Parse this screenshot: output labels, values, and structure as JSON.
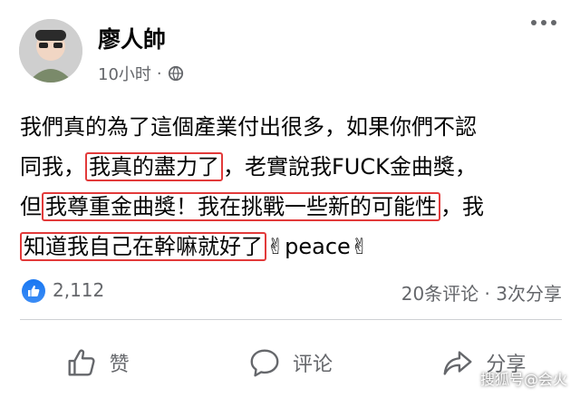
{
  "post": {
    "author": "廖人帥",
    "time": "10小时",
    "dot": "·",
    "lines": [
      {
        "parts": [
          {
            "t": "我們真的為了這個產業付出很多，如果你們不認",
            "hl": false
          }
        ]
      },
      {
        "parts": [
          {
            "t": "同我，",
            "hl": false
          },
          {
            "t": "我真的盡力了",
            "hl": true
          },
          {
            "t": "，老實說我FUCK金曲獎，",
            "hl": false
          }
        ]
      },
      {
        "parts": [
          {
            "t": "但",
            "hl": false
          },
          {
            "t": "我尊重金曲獎！我在挑戰一些新的可能性",
            "hl": true
          },
          {
            "t": "，我",
            "hl": false
          }
        ]
      },
      {
        "parts": [
          {
            "t": "知道我自己在幹嘛就好了",
            "hl": true
          },
          {
            "t": "✌peace✌",
            "hl": false
          }
        ]
      }
    ]
  },
  "stats": {
    "likes": "2,112",
    "comments_shares": "20条评论 · 3次分享"
  },
  "actions": {
    "like": "赞",
    "comment": "评论",
    "share": "分享"
  },
  "watermark": "搜狐号@会火",
  "colors": {
    "highlight": "#e23a3a",
    "like_blue": "#1877f2",
    "muted": "#65676b"
  }
}
